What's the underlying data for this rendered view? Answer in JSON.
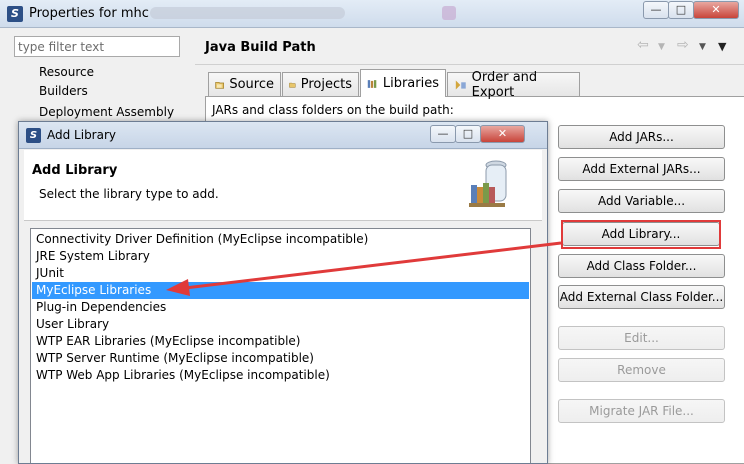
{
  "properties_window": {
    "title": "Properties for mhc",
    "filter": {
      "placeholder": "type filter text",
      "value": ""
    },
    "nav_items": [
      "Resource",
      "Builders",
      "Deployment Assembly"
    ],
    "panel_title": "Java Build Path",
    "tabs": [
      {
        "label": "Source",
        "icon": "source-folder-icon",
        "active": false
      },
      {
        "label": "Projects",
        "icon": "projects-folder-icon",
        "active": false
      },
      {
        "label": "Libraries",
        "icon": "libraries-icon",
        "active": true
      },
      {
        "label": "Order and Export",
        "icon": "order-export-icon",
        "active": false
      }
    ],
    "jars_label": "JARs and class folders on the build path:",
    "buttons": [
      {
        "label": "Add JARs...",
        "enabled": true
      },
      {
        "label": "Add External JARs...",
        "enabled": true
      },
      {
        "label": "Add Variable...",
        "enabled": true
      },
      {
        "label": "Add Library...",
        "enabled": true,
        "highlighted": true
      },
      {
        "label": "Add Class Folder...",
        "enabled": true
      },
      {
        "label": "Add External Class Folder...",
        "enabled": true
      },
      {
        "label": "Edit...",
        "enabled": false
      },
      {
        "label": "Remove",
        "enabled": false
      },
      {
        "label": "Migrate JAR File...",
        "enabled": false
      }
    ]
  },
  "dialog": {
    "title": "Add Library",
    "header_title": "Add Library",
    "header_subtitle": "Select the library type to add.",
    "libraries": [
      {
        "label": "Connectivity Driver Definition (MyEclipse incompatible)",
        "selected": false
      },
      {
        "label": "JRE System Library",
        "selected": false
      },
      {
        "label": "JUnit",
        "selected": false
      },
      {
        "label": "MyEclipse Libraries",
        "selected": true
      },
      {
        "label": "Plug-in Dependencies",
        "selected": false
      },
      {
        "label": "User Library",
        "selected": false
      },
      {
        "label": "WTP EAR Libraries (MyEclipse incompatible)",
        "selected": false
      },
      {
        "label": "WTP Server Runtime (MyEclipse incompatible)",
        "selected": false
      },
      {
        "label": "WTP Web App Libraries (MyEclipse incompatible)",
        "selected": false
      }
    ]
  },
  "colors": {
    "selection": "#3399ff",
    "annotation": "#e03a3a"
  }
}
